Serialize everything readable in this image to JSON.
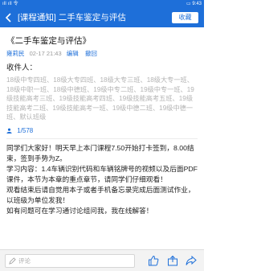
{
  "status_bar": {
    "signal": "ıll ıll 令",
    "battery": "▭",
    "time": "9:43"
  },
  "header": {
    "title": "[课程通知] 二手车鉴定与评估",
    "favorite_label": "收藏"
  },
  "post": {
    "title": "《二手车鉴定与评估》",
    "author": "雍莉民",
    "time": "02-17 21:43",
    "edit_label": "编辑",
    "revoke_label": "撤回"
  },
  "recipients": {
    "label": "收件人：",
    "text": "18级中专四班、18级大专四班、18级大专三班、18级大专一班、18级中职一班、18级中德班、19级中专二班、19级中专一班、19级技能高考三班、19级技能高考四班、19级技能高考五班、19级技能高考二班、19级技能高考一班、19级中德二班、19级中德一班、默认班级"
  },
  "read_count": "1/578",
  "body": {
    "line1": "同学们大家好！明天早上本门课程7.50开始打卡签到，8.00结束，签到手势为Z。",
    "line2": "学习内容：1.4车辆识别代码和车辆铭牌号的视频以及后面PDF课件，本节为本章的重点章节，请同学们仔细观看！",
    "line3": "观看结束后请自觉用本子或者手机备忘录完成后面测试作业，以班级为单位发我！",
    "line4": "如有问题可在学习通讨论组问我，我在线解答！"
  },
  "bottom_bar": {
    "comment_placeholder": "评论"
  },
  "icons": [
    "back-arrow-icon",
    "pen-icon",
    "like-icon",
    "share-icon",
    "forward-icon",
    "user-icon"
  ],
  "colors": {
    "accent": "#1e6fd9",
    "muted_text": "#b4b4b4"
  }
}
